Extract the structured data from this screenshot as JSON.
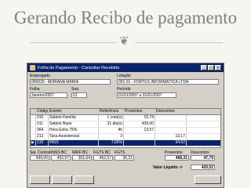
{
  "slide": {
    "title": "Gerando Recibo de pagamento",
    "ornament": "❦"
  },
  "window": {
    "title": "Folha de Pagamento - Consultar Recebido",
    "controls": [
      "_",
      "□",
      "×"
    ]
  },
  "form": {
    "empregado_label": "Empregado",
    "empregado_value": "000030 - ADRIANA MARIA",
    "lotacao_label": "Lotação",
    "lotacao_value": "001.01 - FORTES INFORMÁTICA LTDA",
    "folha_label": "Folha",
    "folha_value": "Janeiro/2007",
    "seq_label": "Seq",
    "seq_value": "01",
    "periodo_label": "Período",
    "periodo_value": "01/01/2007 a 31/01/2007"
  },
  "table": {
    "columns": [
      "",
      "Código",
      "Evento",
      "Referência",
      "Proventos",
      "Descontos"
    ],
    "rows": [
      {
        "marker": "",
        "codigo": "010",
        "evento": "Salário-Família",
        "referencia": "1 cota(s)",
        "proventos": "15,74",
        "descontos": ""
      },
      {
        "marker": "",
        "codigo": "011",
        "evento": "Salário Base",
        "referencia": "31 dia(s)",
        "proventos": "439,00",
        "descontos": ""
      },
      {
        "marker": "",
        "codigo": "064",
        "evento": "Hora Extra 75%",
        "referencia": "4h",
        "proventos": "13,57",
        "descontos": ""
      },
      {
        "marker": "",
        "codigo": "213",
        "evento": "Taxa Assistencial",
        "referencia": "3",
        "proventos": "",
        "descontos": "13,17"
      },
      {
        "marker": "▶",
        "codigo": "310",
        "evento": "INSS",
        "referencia": "7,65%",
        "proventos": "",
        "descontos": "34,62"
      }
    ],
    "selected_row": 4
  },
  "totals": {
    "labels": [
      "Sal. Contrat.",
      "INSS BC",
      "IRRF BC",
      "FGTS BC",
      "FGTS",
      "Proventos",
      "Descontos"
    ],
    "values": [
      "439,00",
      "452,57",
      "301,64",
      "452,57",
      "36,21",
      "468,31",
      "47,79"
    ]
  },
  "footer": {
    "liquido_label": "Valor Líquido ->",
    "liquido_value": "420,52"
  }
}
